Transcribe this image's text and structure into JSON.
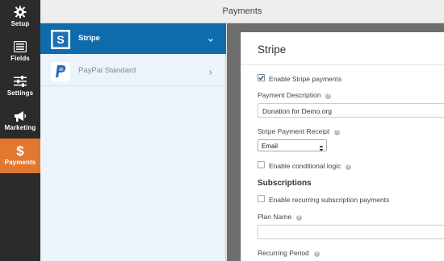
{
  "header": {
    "title": "Payments"
  },
  "nav": [
    {
      "label": "Setup",
      "icon": "gear-icon"
    },
    {
      "label": "Fields",
      "icon": "fields-list-icon"
    },
    {
      "label": "Settings",
      "icon": "sliders-icon"
    },
    {
      "label": "Marketing",
      "icon": "megaphone-icon"
    },
    {
      "label": "Payments",
      "icon": "dollar-icon",
      "active": true
    }
  ],
  "providers": [
    {
      "name": "Stripe",
      "icon": "stripe-logo-icon",
      "active": true
    },
    {
      "name": "PayPal Standard",
      "icon": "paypal-logo-icon",
      "active": false
    }
  ],
  "stripe": {
    "title": "Stripe",
    "enable_label": "Enable Stripe payments",
    "enable_checked": true,
    "description_label": "Payment Description",
    "description_value": "Donation for Demo.org",
    "receipt_label": "Stripe Payment Receipt",
    "receipt_value": "Email",
    "conditional_label": "Enable conditional logic",
    "conditional_checked": false,
    "subscriptions_title": "Subscriptions",
    "recurring_label": "Enable recurring subscription payments",
    "recurring_checked": false,
    "plan_name_label": "Plan Name",
    "plan_name_value": "",
    "recurring_period_label": "Recurring Period"
  },
  "colors": {
    "accent": "#e27730",
    "nav_bg": "#2b2b2b",
    "provider_active": "#0e6cad",
    "provider_panel": "#ebf3fb",
    "checkbox_check": "#0e6cad"
  }
}
